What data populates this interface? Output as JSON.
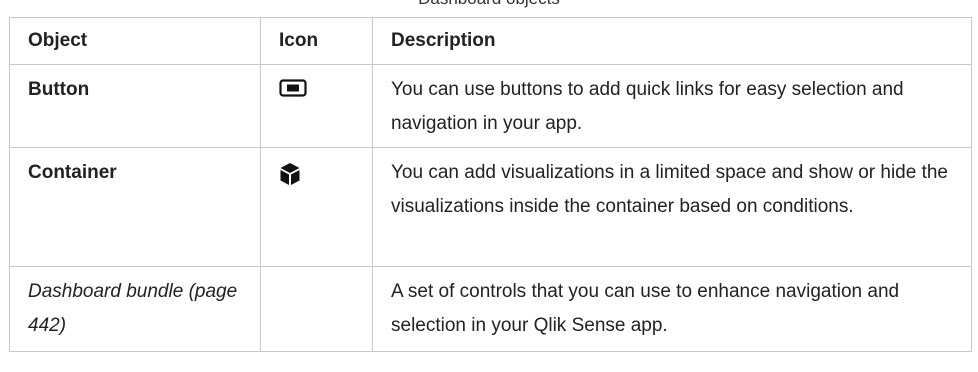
{
  "caption": "Dashboard objects",
  "table": {
    "headers": {
      "object": "Object",
      "icon": "Icon",
      "description": "Description"
    },
    "rows": [
      {
        "object": "Button",
        "icon": "button-icon",
        "description": "You can use buttons to add quick links for easy selection and navigation in your app."
      },
      {
        "object": "Container",
        "icon": "container-cube-icon",
        "description": "You can add visualizations in a limited space and show or hide the visualizations inside the container based on conditions."
      },
      {
        "object": "Dashboard bundle (page 442)",
        "icon": "",
        "description": "A set of controls that you can use to enhance navigation and selection in your Qlik Sense app."
      }
    ]
  },
  "colors": {
    "border": "#c8c8c8",
    "text": "#222222"
  }
}
